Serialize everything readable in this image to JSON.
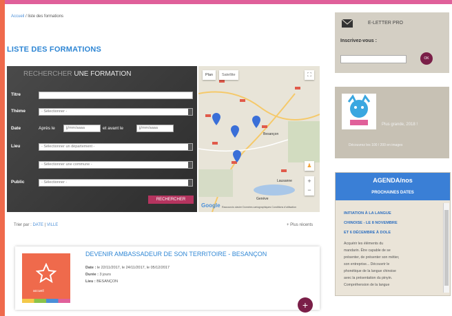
{
  "breadcrumb": {
    "home": "Accueil",
    "current": "liste des formations"
  },
  "page_title": "LISTE DES FORMATIONS",
  "search": {
    "heading_light": "RECHERCHER",
    "heading_bold": "UNE FORMATION",
    "label_title": "Titre",
    "label_theme": "Thème",
    "label_date": "Date",
    "label_place": "Lieu",
    "label_public": "Public",
    "theme_value": "- Sélectionner -",
    "date_after": "Après le",
    "date_and_before": "et avant le",
    "date_placeholder": "jj/mm/aaaa",
    "department_value": "- Sélectionner un département -",
    "commune_value": "- Sélectionner une commune -",
    "public_value": "- Sélectionner -",
    "submit_label": "RECHERCHER"
  },
  "map": {
    "tab_plan": "Plan",
    "tab_satellite": "Satellite",
    "city": "Besançon",
    "city2": "Genève",
    "city3": "Lausanne",
    "logo": "Google",
    "attribution": "Raccourcis clavier   Données cartographiques   Conditions d'utilisation"
  },
  "sort": {
    "label": "Trier par :",
    "date": "DATE",
    "sep": "|",
    "ville": "VILLE"
  },
  "more_results": "+ Plus récents",
  "results": [
    {
      "title": "DEVENIR AMBASSADEUR DE SON TERRITOIRE - BESANÇON",
      "date_label": "Date :",
      "date_value": "le 22/11/2017, le 24/11/2017, le 05/12/2017",
      "duration_label": "Durée :",
      "duration_value": "3 jours",
      "place_label": "Lieu :",
      "place_value": "BESANÇON",
      "image_text": "accueil"
    }
  ],
  "newsletter": {
    "title": "E-LETTER PRO",
    "label": "Inscrivez-vous :",
    "ok": "OK"
  },
  "promo": {
    "line1": "Plus grande, 2018 !",
    "line2": "Découvrez les 100 / 200 en images"
  },
  "agenda": {
    "title": "AGENDA/nos",
    "subtitle": "PROCHAINES DATES",
    "event_line1": "INITIATION À LA LANGUE",
    "event_line2": "CHINOISE - LE 8 NOVEMBRE",
    "event_line3": "ET 6 DÉCEMBRE À DOLE",
    "desc": [
      "Acquérir les éléments du",
      "mandarin. Être capable de se",
      "présenter, de présenter son métier,",
      "son entreprise... Découvrir le",
      "phonétique de la langue chinoise",
      "avec la présentation du pinyin.",
      "Compréhension de la langue"
    ]
  },
  "colors": {
    "accent": "#2e86d4",
    "brand_pink": "#e0609a",
    "brand_orange": "#ef6a4c",
    "button_plum": "#7a1f48"
  }
}
